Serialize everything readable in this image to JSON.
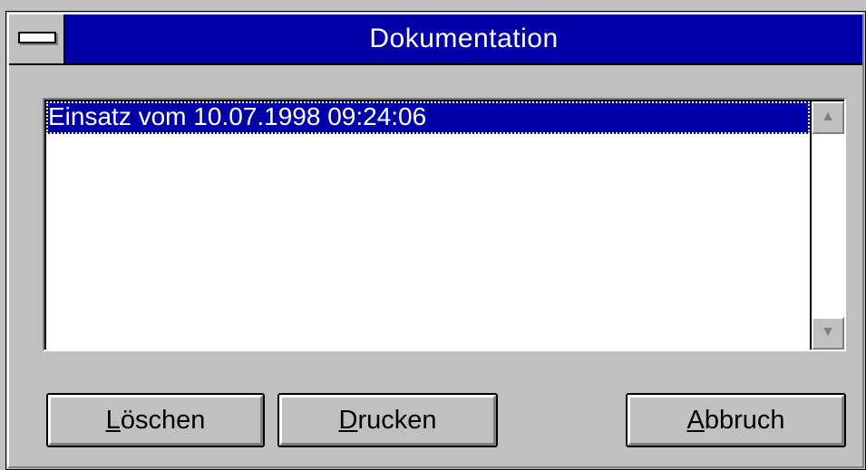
{
  "window": {
    "title": "Dokumentation"
  },
  "list": {
    "items": [
      {
        "label": "Einsatz vom 10.07.1998 09:24:06",
        "selected": true
      }
    ]
  },
  "buttons": {
    "delete": {
      "mnemonic": "L",
      "rest": "öschen"
    },
    "print": {
      "mnemonic": "D",
      "rest": "rucken"
    },
    "cancel": {
      "mnemonic": "A",
      "rest": "bbruch"
    }
  },
  "icons": {
    "system_menu": "system-menu-icon",
    "scroll_up": "scroll-up-arrow-icon",
    "scroll_down": "scroll-down-arrow-icon"
  },
  "colors": {
    "titlebar": "#0000a8",
    "face": "#c0c0c0",
    "selection": "#0000a8"
  }
}
